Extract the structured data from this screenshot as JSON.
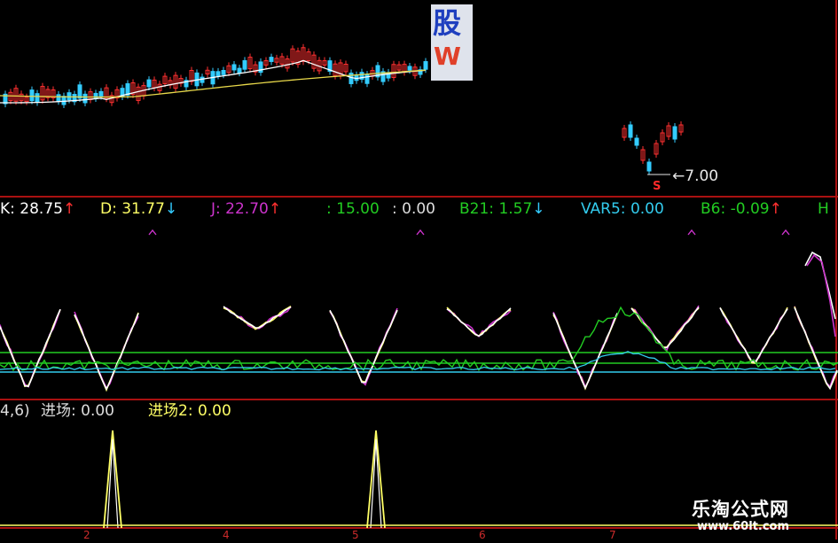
{
  "colors": {
    "up": "#ff3030",
    "down": "#33ccff",
    "ma1": "#ffffff",
    "ma2": "#e8d84a",
    "k": "#ffffff",
    "d": "#ffff66",
    "j": "#cc33cc",
    "green": "#22cc22",
    "cyan": "#33ccee",
    "border": "#aa1111"
  },
  "logo": {
    "char": "股",
    "letter": "W"
  },
  "price_marker": {
    "value": "7.00",
    "signal": "S"
  },
  "kdj_header": {
    "k": {
      "label": "K:",
      "value": "28.75",
      "arrow": "↑"
    },
    "d": {
      "label": "D:",
      "value": "31.77",
      "arrow": "↓"
    },
    "j": {
      "label": "J:",
      "value": "22.70",
      "arrow": "↑"
    },
    "m1": {
      "label": ":",
      "value": "15.00"
    },
    "m2": {
      "label": ":",
      "value": "0.00"
    },
    "b21": {
      "label": "B21:",
      "value": "1.57",
      "arrow": "↓"
    },
    "var5": {
      "label": "VAR5:",
      "value": "0.00"
    },
    "b6": {
      "label": "B6:",
      "value": "-0.09",
      "arrow": "↑"
    },
    "cut": "H"
  },
  "entry_header": {
    "params": "4,6)",
    "entry1": {
      "label": "进场:",
      "value": "0.00"
    },
    "entry2": {
      "label": "进场2:",
      "value": "0.00"
    }
  },
  "x_ticks": [
    "2",
    "4",
    "5",
    "6",
    "7"
  ],
  "watermark": {
    "title": "乐淘公式网",
    "url": "www.60lt.com"
  }
}
